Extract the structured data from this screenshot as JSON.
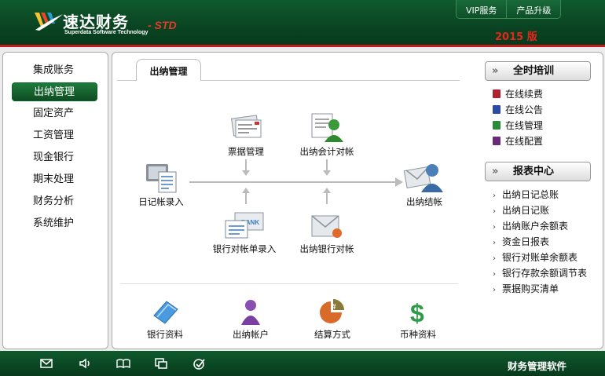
{
  "header": {
    "logo_title": "速达财务",
    "logo_sub": "Superdata Software Technology",
    "logo_std": "- STD",
    "version": "2015 版",
    "buttons": [
      "VIP服务",
      "产品升级"
    ]
  },
  "sidebar": {
    "items": [
      {
        "label": "集成账务",
        "active": false
      },
      {
        "label": "出纳管理",
        "active": true
      },
      {
        "label": "固定资产",
        "active": false
      },
      {
        "label": "工资管理",
        "active": false
      },
      {
        "label": "现金银行",
        "active": false
      },
      {
        "label": "期末处理",
        "active": false
      },
      {
        "label": "财务分析",
        "active": false
      },
      {
        "label": "系统维护",
        "active": false
      }
    ]
  },
  "main": {
    "tab_label": "出纳管理",
    "flow": {
      "journal": "日记帐录入",
      "bills": "票据管理",
      "cashier_reconcile": "出纳会计对帐",
      "statement_entry": "银行对帐单录入",
      "bank_reconcile": "出纳银行对帐",
      "closing": "出纳结帐"
    },
    "bottom": [
      "银行资料",
      "出纳帐户",
      "结算方式",
      "币种资料"
    ]
  },
  "right": {
    "training": {
      "title": "全时培训",
      "links": [
        "在线续费",
        "在线公告",
        "在线管理",
        "在线配置"
      ]
    },
    "reports": {
      "title": "报表中心",
      "links": [
        "出纳日记总账",
        "出纳日记账",
        "出纳账户余额表",
        "资金日报表",
        "银行对账单余额表",
        "银行存款余额调节表",
        "票据购买清单"
      ]
    }
  },
  "footer": {
    "icons": [
      "mail-icon",
      "speaker-icon",
      "book-icon",
      "window-icon",
      "check-icon"
    ],
    "text": "财务管理软件"
  },
  "colors": {
    "header_green": "#0a4422",
    "accent_red": "#c21b1b",
    "version_red": "#e8261c",
    "active_green": "#1f7a3c"
  }
}
